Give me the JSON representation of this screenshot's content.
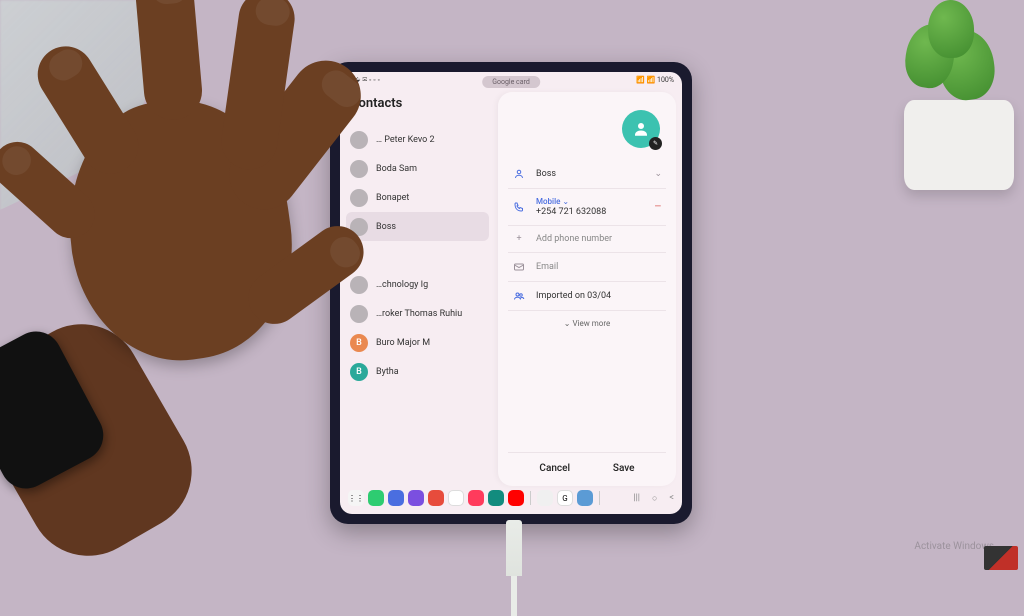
{
  "status": {
    "time_left_glyphs": "⏱ ⬙ ✉ ◦ ◦ ◦",
    "right_glyphs": "📶 📶 100%",
    "battery": "100%"
  },
  "app": {
    "title": "Contacts",
    "storage_label": "Google card"
  },
  "contacts": [
    {
      "initial": "",
      "name": "…",
      "avatar": "hidden"
    },
    {
      "initial": "",
      "name": "… Peter Kevo 2",
      "avatar": "gray"
    },
    {
      "initial": "",
      "name": "Boda Sam",
      "avatar": "gray"
    },
    {
      "initial": "",
      "name": "Bonapet",
      "avatar": "gray"
    },
    {
      "initial": "",
      "name": "Boss",
      "avatar": "gray",
      "selected": true
    },
    {
      "initial": "",
      "name": "…",
      "avatar": "hidden"
    },
    {
      "initial": "",
      "name": "…chnology Ig",
      "avatar": "gray"
    },
    {
      "initial": "",
      "name": "…roker Thomas Ruhiu",
      "avatar": "gray"
    },
    {
      "initial": "B",
      "name": "Buro Major M",
      "avatar": "orange"
    },
    {
      "initial": "B",
      "name": "Bytha",
      "avatar": "teal"
    }
  ],
  "edit": {
    "name": "Boss",
    "phone_type": "Mobile",
    "phone_number": "+254 721 632088",
    "add_phone": "Add phone number",
    "email_placeholder": "Email",
    "group_label": "Imported on 03/04",
    "view_more": "View more",
    "cancel": "Cancel",
    "save": "Save"
  },
  "watermark": {
    "line1": "Activate Windows"
  },
  "icons": {
    "person": "person-icon",
    "phone": "phone-icon",
    "plus": "plus-icon",
    "mail": "mail-icon",
    "group": "group-icon",
    "chevron_down": "chevron-down-icon",
    "minus": "minus-icon",
    "pencil": "pencil-icon"
  },
  "colors": {
    "accent_blue": "#4a6ee0",
    "accent_teal": "#3cc2b0",
    "danger": "#d9534f"
  }
}
